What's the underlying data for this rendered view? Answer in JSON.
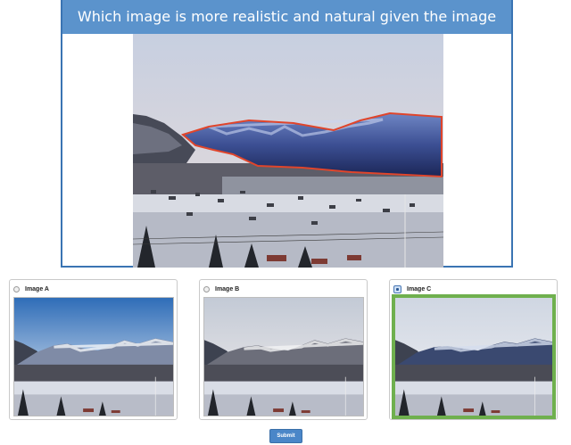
{
  "question": {
    "title": "Which image is more realistic and natural given the image below?"
  },
  "options": [
    {
      "label": "Image A",
      "selected": false
    },
    {
      "label": "Image B",
      "selected": false
    },
    {
      "label": "Image C",
      "selected": true
    }
  ],
  "submit_label": "Submit",
  "colors": {
    "header_bg": "#5b93cc",
    "panel_border": "#3a74b3",
    "selection_border": "#6fb04e",
    "composite_outline": "#e0452b",
    "submit_bg": "#4a86c8"
  },
  "icons": {
    "radio_unchecked": "radio-unchecked-icon",
    "radio_checked": "radio-checked-icon"
  }
}
